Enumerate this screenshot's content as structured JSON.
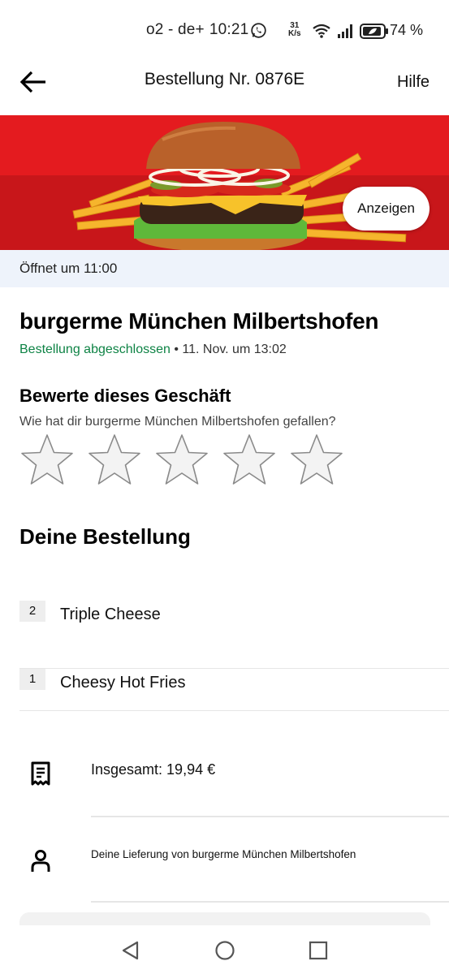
{
  "status_bar": {
    "carrier": "o2 - de+",
    "time": "10:21",
    "net_speed_value": "31",
    "net_speed_unit": "K/s",
    "battery": "74 %"
  },
  "header": {
    "title": "Bestellung Nr. 0876E",
    "help": "Hilfe"
  },
  "banner": {
    "button_label": "Anzeigen"
  },
  "open_notice": "Öffnet um 11:00",
  "store": {
    "name": "burgerme München Milbertshofen",
    "status": "Bestellung abgeschlossen",
    "date": " • 11. Nov. um 13:02"
  },
  "rating": {
    "title": "Bewerte dieses Geschäft",
    "question": "Wie hat dir burgerme München Milbertshofen gefallen?",
    "stars_selected": 0,
    "stars_total": 5
  },
  "order": {
    "heading": "Deine Bestellung",
    "items": [
      {
        "qty": "2",
        "name": "Triple Cheese"
      },
      {
        "qty": "1",
        "name": "Cheesy Hot Fries"
      }
    ]
  },
  "summary": {
    "total": "Insgesamt: 19,94 €",
    "delivery": "Deine Lieferung von burgerme München Milbertshofen"
  },
  "colors": {
    "brand_red": "#e41b1f",
    "status_green": "#0e8345",
    "notice_bg": "#eef3fb"
  },
  "icons": {
    "back": "arrow-left-icon",
    "receipt": "receipt-icon",
    "person": "person-icon",
    "star": "star-outline-icon"
  }
}
